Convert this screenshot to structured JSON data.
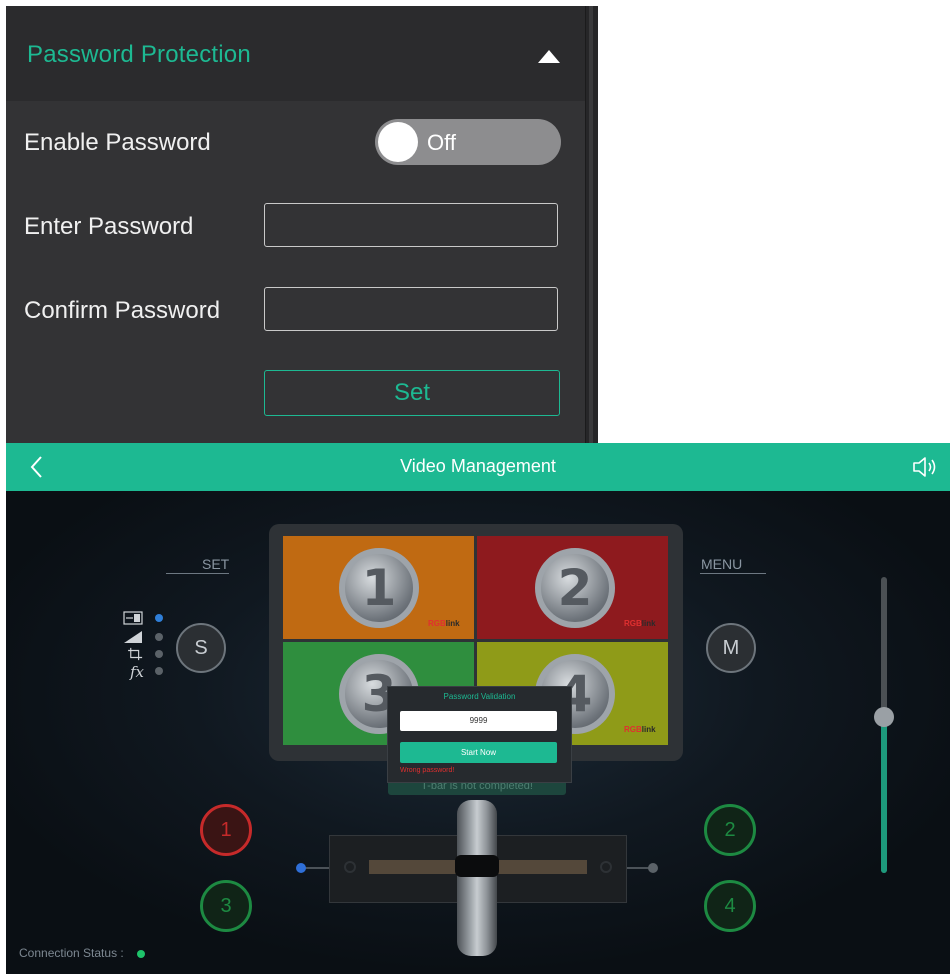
{
  "password_panel": {
    "title": "Password Protection",
    "enable_label": "Enable Password",
    "toggle_text": "Off",
    "enter_label": "Enter Password",
    "enter_value": "",
    "confirm_label": "Confirm Password",
    "confirm_value": "",
    "set_button": "Set",
    "accent_color": "#1db992"
  },
  "app": {
    "title": "Video Management",
    "set_label": "SET",
    "menu_label": "MENU",
    "s_button": "S",
    "m_button": "M",
    "inputs": [
      {
        "label": "1",
        "color": "#e03a3a"
      },
      {
        "label": "2",
        "color": "#1fa14a"
      },
      {
        "label": "3",
        "color": "#1fa14a"
      },
      {
        "label": "4",
        "color": "#1fa14a"
      }
    ],
    "preview": {
      "quadrants": [
        {
          "number": "1",
          "color": "#c06a12"
        },
        {
          "number": "2",
          "color": "#8e1a1e"
        },
        {
          "number": "3",
          "color": "#2f8e3e"
        },
        {
          "number": "4",
          "color": "#8f9b18"
        }
      ],
      "logo_red": "RGB",
      "logo_dark": "link"
    },
    "modal": {
      "title": "Password Validation",
      "input_value": "9999",
      "button": "Start Now",
      "error": "Wrong password!"
    },
    "toast": "T-bar is not completed!",
    "volume_level": 0.53,
    "connection_label": "Connection Status :",
    "connection_color": "#1ec36a",
    "mode_icons": [
      "pip-icon",
      "fade-icon",
      "crop-icon",
      "fx-icon"
    ],
    "mode_fx_label": "fx"
  }
}
